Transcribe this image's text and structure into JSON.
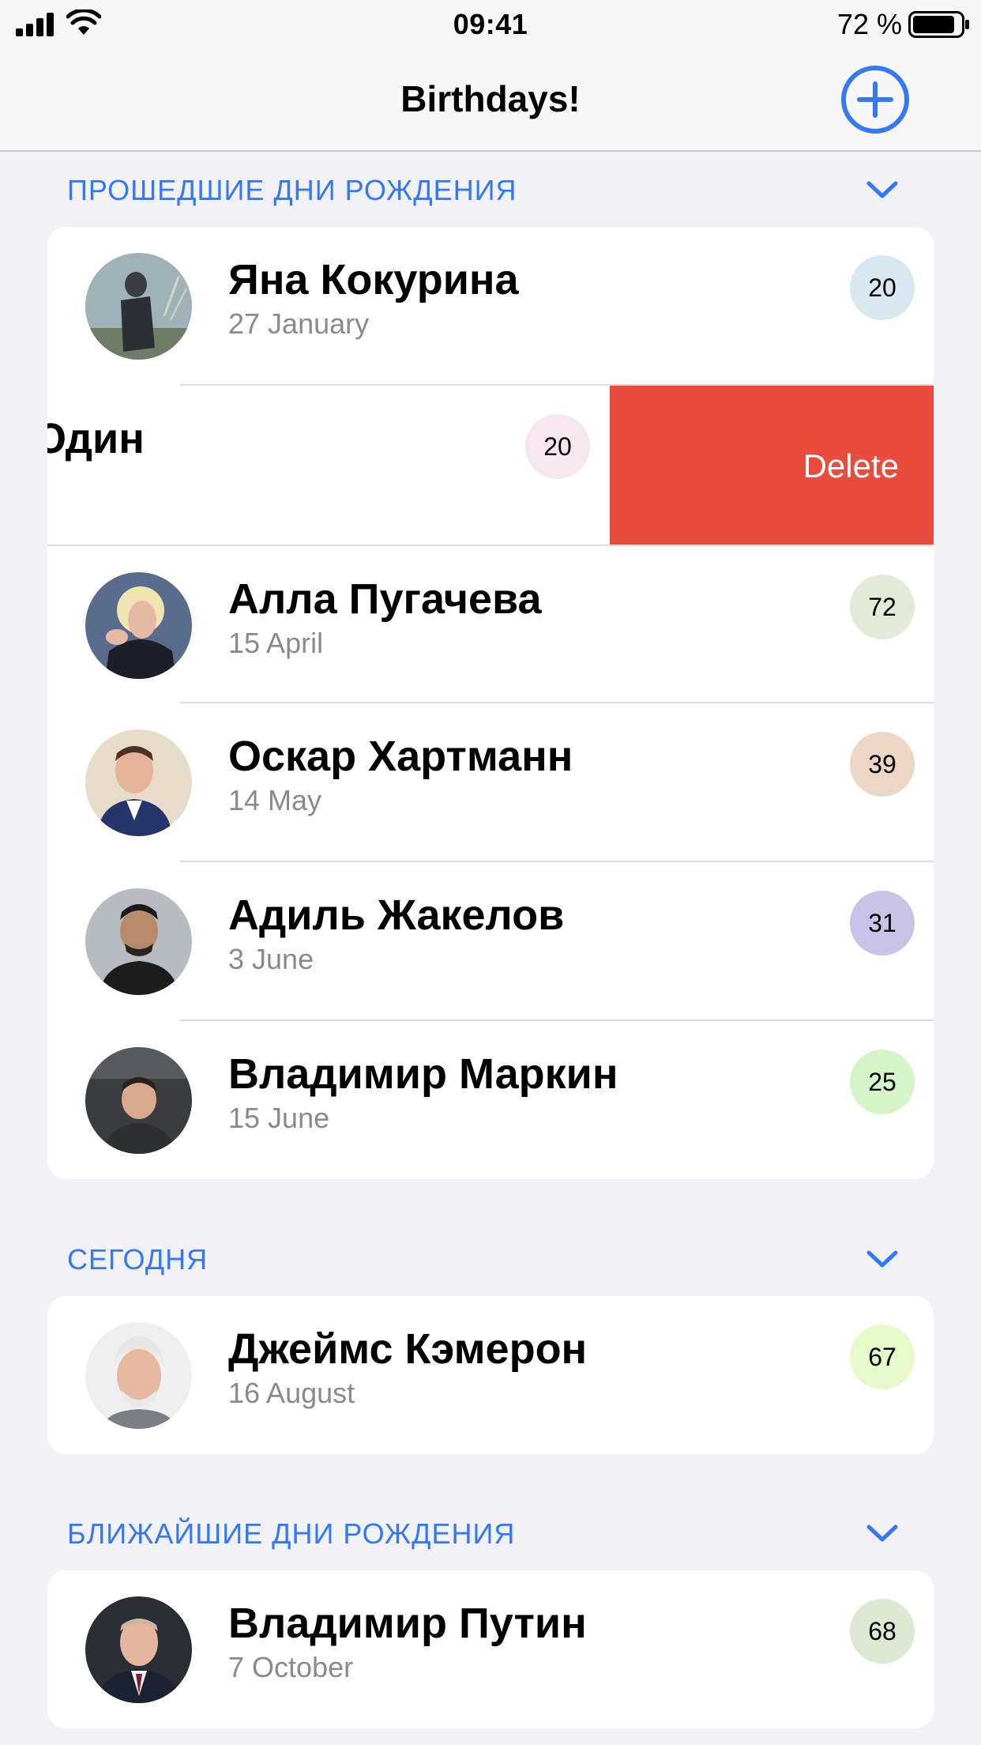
{
  "status_bar": {
    "time": "09:41",
    "battery_percent": "72 %",
    "signal_icon": "cellular-signal-icon",
    "wifi_icon": "wifi-icon",
    "battery_icon": "battery-icon"
  },
  "nav": {
    "title": "Birthdays!",
    "add_icon": "plus-circle-icon"
  },
  "colors": {
    "accent": "#3478f6",
    "delete": "#e94b3c",
    "background": "#f2f1f6"
  },
  "sections": [
    {
      "title": "ПРОШЕДШИЕ ДНИ РОЖДЕНИЯ",
      "chevron_icon": "chevron-down-icon",
      "rows": [
        {
          "name": "Яна Кокурина",
          "date": "27 January",
          "age": "20",
          "badge_color": "#d7e8f0"
        },
        {
          "name": "Юрий Юдин",
          "visible_name": "рий Юдин",
          "date": "",
          "age": "20",
          "badge_color": "#f6e6ee",
          "swiped": true,
          "delete_label": "Delete"
        },
        {
          "name": "Алла Пугачева",
          "date": "15 April",
          "age": "72",
          "badge_color": "#e3ebd8"
        },
        {
          "name": "Оскар Хартманн",
          "date": "14 May",
          "age": "39",
          "badge_color": "#ecd6c6"
        },
        {
          "name": "Адиль Жакелов",
          "date": "3 June",
          "age": "31",
          "badge_color": "#c9c3ea"
        },
        {
          "name": "Владимир Маркин",
          "date": "15 June",
          "age": "25",
          "badge_color": "#d5f5c9"
        }
      ]
    },
    {
      "title": "СЕГОДНЯ",
      "chevron_icon": "chevron-down-icon",
      "rows": [
        {
          "name": "Джеймс Кэмерон",
          "date": "16 August",
          "age": "67",
          "badge_color": "#e6f9c8"
        }
      ]
    },
    {
      "title": "БЛИЖАЙШИЕ ДНИ РОЖДЕНИЯ",
      "chevron_icon": "chevron-down-icon",
      "rows": [
        {
          "name": "Владимир Путин",
          "date": "7 October",
          "age": "68",
          "badge_color": "#dde8d2"
        }
      ]
    }
  ]
}
